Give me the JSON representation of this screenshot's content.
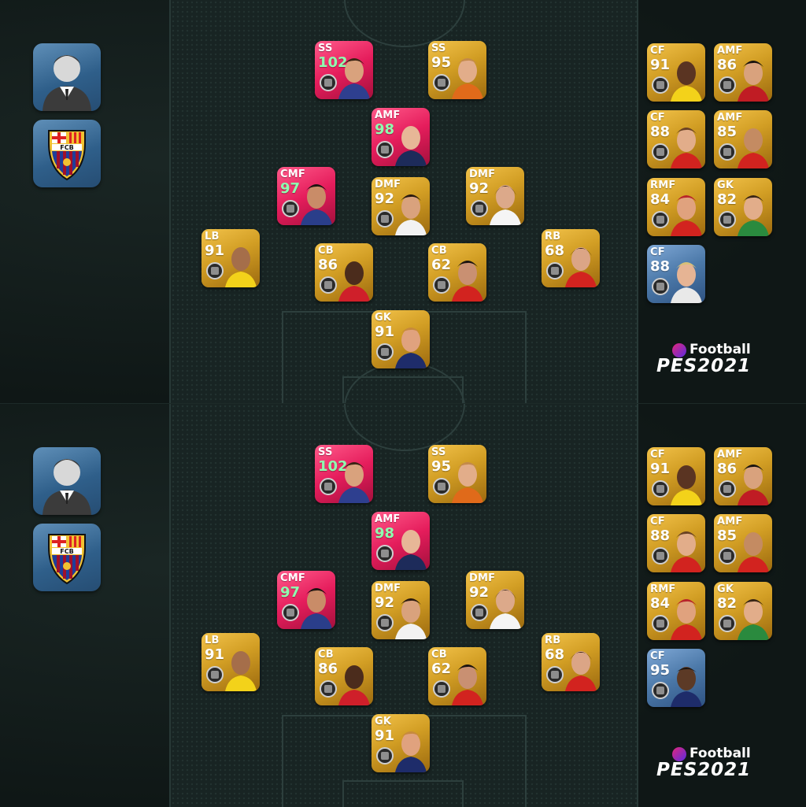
{
  "brand": {
    "efootball": "Football",
    "pes": "PES2021"
  },
  "panels": [
    {
      "side_icons": [
        "manager-avatar-icon",
        "fc-barcelona-crest-icon"
      ],
      "formation": [
        {
          "pos": "SS",
          "ovr": "102",
          "style": "pink"
        },
        {
          "pos": "SS",
          "ovr": "95",
          "style": "gold"
        },
        {
          "pos": "AMF",
          "ovr": "98",
          "style": "pink"
        },
        {
          "pos": "CMF",
          "ovr": "97",
          "style": "pink"
        },
        {
          "pos": "DMF",
          "ovr": "92",
          "style": "gold"
        },
        {
          "pos": "DMF",
          "ovr": "92",
          "style": "gold"
        },
        {
          "pos": "LB",
          "ovr": "91",
          "style": "gold"
        },
        {
          "pos": "CB",
          "ovr": "86",
          "style": "gold"
        },
        {
          "pos": "CB",
          "ovr": "62",
          "style": "gold"
        },
        {
          "pos": "RB",
          "ovr": "68",
          "style": "gold"
        },
        {
          "pos": "GK",
          "ovr": "91",
          "style": "gold"
        }
      ],
      "subs": [
        {
          "pos": "CF",
          "ovr": "91",
          "style": "gold"
        },
        {
          "pos": "AMF",
          "ovr": "86",
          "style": "gold"
        },
        {
          "pos": "CF",
          "ovr": "88",
          "style": "gold"
        },
        {
          "pos": "AMF",
          "ovr": "85",
          "style": "gold"
        },
        {
          "pos": "RMF",
          "ovr": "84",
          "style": "gold"
        },
        {
          "pos": "GK",
          "ovr": "82",
          "style": "gold"
        },
        {
          "pos": "CF",
          "ovr": "88",
          "style": "blue"
        }
      ]
    },
    {
      "side_icons": [
        "manager-avatar-icon",
        "fc-barcelona-crest-icon"
      ],
      "formation": [
        {
          "pos": "SS",
          "ovr": "102",
          "style": "pink"
        },
        {
          "pos": "SS",
          "ovr": "95",
          "style": "gold"
        },
        {
          "pos": "AMF",
          "ovr": "98",
          "style": "pink"
        },
        {
          "pos": "CMF",
          "ovr": "97",
          "style": "pink"
        },
        {
          "pos": "DMF",
          "ovr": "92",
          "style": "gold"
        },
        {
          "pos": "DMF",
          "ovr": "92",
          "style": "gold"
        },
        {
          "pos": "LB",
          "ovr": "91",
          "style": "gold"
        },
        {
          "pos": "CB",
          "ovr": "86",
          "style": "gold"
        },
        {
          "pos": "CB",
          "ovr": "62",
          "style": "gold"
        },
        {
          "pos": "RB",
          "ovr": "68",
          "style": "gold"
        },
        {
          "pos": "GK",
          "ovr": "91",
          "style": "gold"
        }
      ],
      "subs": [
        {
          "pos": "CF",
          "ovr": "91",
          "style": "gold"
        },
        {
          "pos": "AMF",
          "ovr": "86",
          "style": "gold"
        },
        {
          "pos": "CF",
          "ovr": "88",
          "style": "gold"
        },
        {
          "pos": "AMF",
          "ovr": "85",
          "style": "gold"
        },
        {
          "pos": "RMF",
          "ovr": "84",
          "style": "gold"
        },
        {
          "pos": "GK",
          "ovr": "82",
          "style": "gold"
        },
        {
          "pos": "CF",
          "ovr": "95",
          "style": "blue"
        }
      ]
    }
  ],
  "colors": {
    "gold": "#d29e24",
    "pink": "#e51d5c",
    "blue": "#4b78a8",
    "pitch": "#182423",
    "background": "#111a1a"
  }
}
